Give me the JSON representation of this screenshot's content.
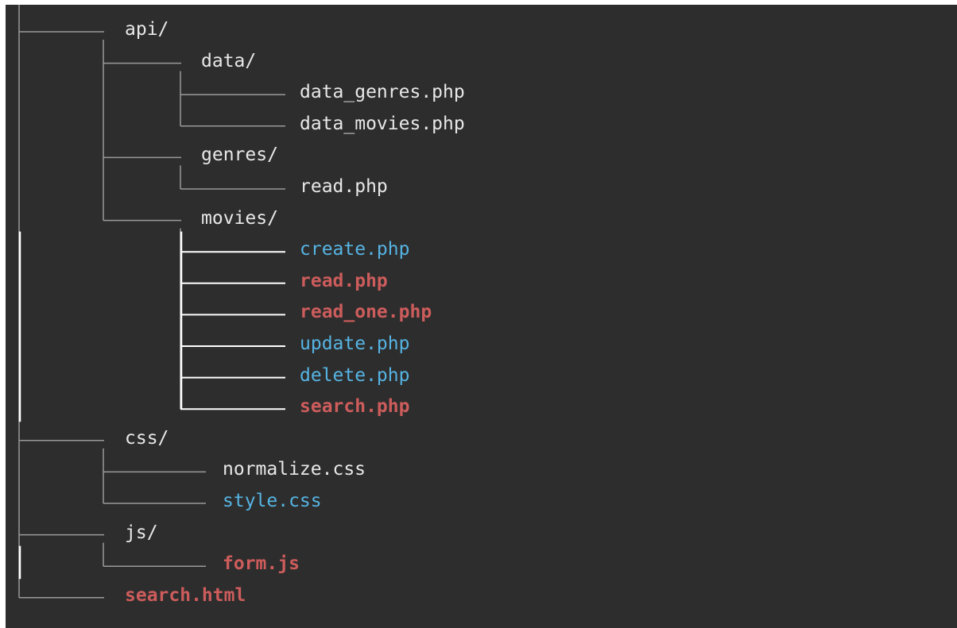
{
  "tree": {
    "accent_colors": {
      "default": "#e8e8e8",
      "blue": "#56b4e3",
      "red": "#cd5c5c",
      "connector": "#9a9a9a",
      "bold_bar": "#ffffff"
    },
    "entries": [
      {
        "label": "api/",
        "depth": 0,
        "color": "default",
        "kind": "folder",
        "last": false
      },
      {
        "label": "data/",
        "depth": 1,
        "color": "default",
        "kind": "folder",
        "last": false
      },
      {
        "label": "data_genres.php",
        "depth": 2,
        "color": "default",
        "kind": "file",
        "last": false
      },
      {
        "label": "data_movies.php",
        "depth": 2,
        "color": "default",
        "kind": "file",
        "last": true
      },
      {
        "label": "genres/",
        "depth": 1,
        "color": "default",
        "kind": "folder",
        "last": false
      },
      {
        "label": "read.php",
        "depth": 2,
        "color": "default",
        "kind": "file",
        "last": true
      },
      {
        "label": "movies/",
        "depth": 1,
        "color": "default",
        "kind": "folder",
        "last": true
      },
      {
        "label": "create.php",
        "depth": 2,
        "color": "blue",
        "kind": "file",
        "last": false
      },
      {
        "label": "read.php",
        "depth": 2,
        "color": "red",
        "kind": "file",
        "last": false
      },
      {
        "label": "read_one.php",
        "depth": 2,
        "color": "red",
        "kind": "file",
        "last": false
      },
      {
        "label": "update.php",
        "depth": 2,
        "color": "blue",
        "kind": "file",
        "last": false
      },
      {
        "label": "delete.php",
        "depth": 2,
        "color": "blue",
        "kind": "file",
        "last": false
      },
      {
        "label": "search.php",
        "depth": 2,
        "color": "red",
        "kind": "file",
        "last": true
      },
      {
        "label": "css/",
        "depth": 0,
        "color": "default",
        "kind": "folder",
        "last": false
      },
      {
        "label": "normalize.css",
        "depth": 1,
        "color": "default",
        "kind": "file",
        "last": false
      },
      {
        "label": "style.css",
        "depth": 1,
        "color": "blue",
        "kind": "file",
        "last": true
      },
      {
        "label": "js/",
        "depth": 0,
        "color": "default",
        "kind": "folder",
        "last": false
      },
      {
        "label": "form.js",
        "depth": 1,
        "color": "red",
        "kind": "file",
        "last": true
      },
      {
        "label": "search.html",
        "depth": 0,
        "color": "red",
        "kind": "file",
        "last": true
      }
    ]
  }
}
